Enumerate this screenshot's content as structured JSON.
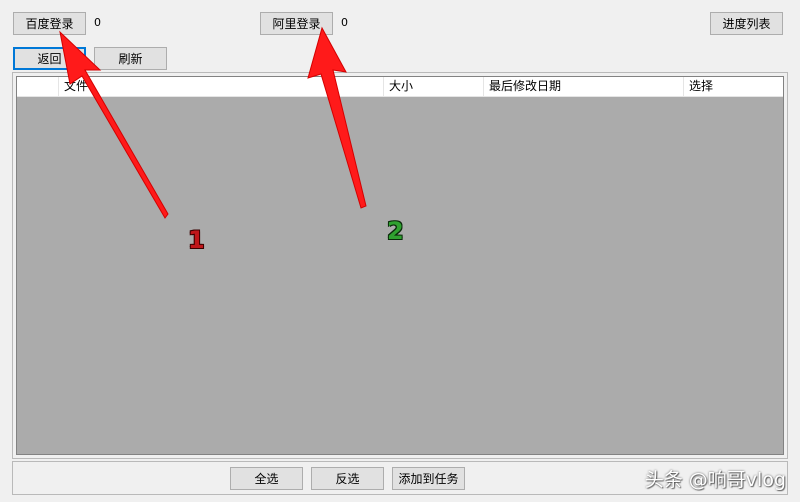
{
  "toolbar": {
    "baidu_login": "百度登录",
    "baidu_count": "0",
    "ali_login": "阿里登录",
    "ali_count": "0",
    "progress_list": "进度列表",
    "back": "返回",
    "refresh": "刷新"
  },
  "grid": {
    "columns": [
      "",
      "文件",
      "大小",
      "最后修改日期",
      "选择"
    ]
  },
  "footer": {
    "select_all": "全选",
    "invert_select": "反选",
    "add_to_task": "添加到任务"
  },
  "annotations": {
    "callout_1": "1",
    "callout_2": "2",
    "arrow_color": "#ff1a1a"
  },
  "watermark": "头条 @响哥vlog"
}
